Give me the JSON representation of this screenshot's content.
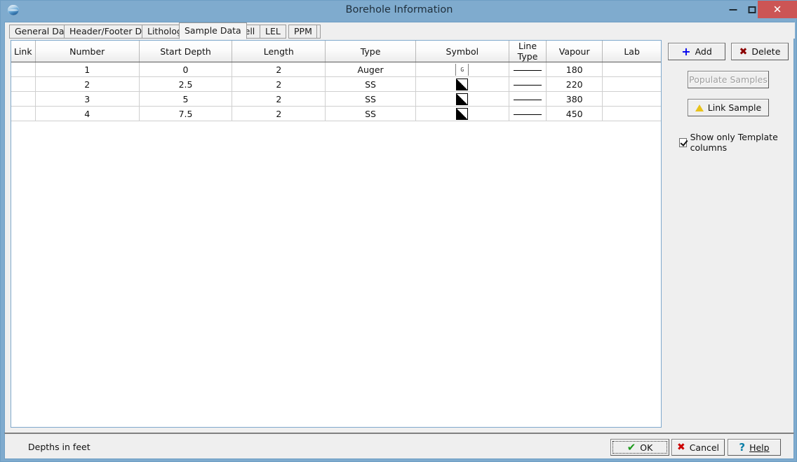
{
  "window": {
    "title": "Borehole Information",
    "icon": "globe-icon",
    "controls": {
      "minimize": "–",
      "maximize": "□",
      "close": "✕"
    },
    "accent_titlebar": "#7FABCE",
    "accent_close": "#CC5555"
  },
  "tabs": [
    {
      "label": "General Data",
      "selected": false
    },
    {
      "label": "Header/Footer Data",
      "selected": false
    },
    {
      "label": "Lithology",
      "selected": false
    },
    {
      "label": "Sample Data",
      "selected": true
    },
    {
      "label": "Well",
      "selected": false
    },
    {
      "label": "LEL",
      "selected": false
    },
    {
      "label": "PPM",
      "selected": false
    }
  ],
  "grid": {
    "columns": [
      {
        "label": "Link"
      },
      {
        "label": "Number"
      },
      {
        "label": "Start Depth"
      },
      {
        "label": "Length"
      },
      {
        "label": "Type"
      },
      {
        "label": "Symbol"
      },
      {
        "label": "Line Type"
      },
      {
        "label": "Vapour"
      },
      {
        "label": "Lab"
      }
    ],
    "rows": [
      {
        "link": "",
        "number": "1",
        "start_depth": "0",
        "length": "2",
        "type": "Auger",
        "symbol": "edit-cell",
        "symbol_char": "G",
        "line_type": "solid-line",
        "vapour": "180",
        "lab": ""
      },
      {
        "link": "",
        "number": "2",
        "start_depth": "2.5",
        "length": "2",
        "type": "SS",
        "symbol": "diagonal-hatch",
        "line_type": "solid-line",
        "vapour": "220",
        "lab": ""
      },
      {
        "link": "",
        "number": "3",
        "start_depth": "5",
        "length": "2",
        "type": "SS",
        "symbol": "diagonal-hatch",
        "line_type": "solid-line",
        "vapour": "380",
        "lab": ""
      },
      {
        "link": "",
        "number": "4",
        "start_depth": "7.5",
        "length": "2",
        "type": "SS",
        "symbol": "diagonal-hatch",
        "line_type": "solid-line",
        "vapour": "450",
        "lab": ""
      }
    ]
  },
  "sidepanel": {
    "add_label": "Add",
    "add_icon": "plus-icon",
    "delete_label": "Delete",
    "delete_icon": "x-icon",
    "populate_label": "Populate Samples",
    "populate_disabled": true,
    "link_sample_label": "Link Sample",
    "link_sample_icon": "warning-triangle-icon",
    "show_only_template_label": "Show only Template columns",
    "show_only_template_checked": true
  },
  "bottombar": {
    "status": "Depths in feet",
    "ok_label": "OK",
    "ok_icon": "green-check-icon",
    "cancel_label": "Cancel",
    "cancel_icon": "red-x-icon",
    "help_label": "Help",
    "help_icon": "question-mark-icon"
  }
}
